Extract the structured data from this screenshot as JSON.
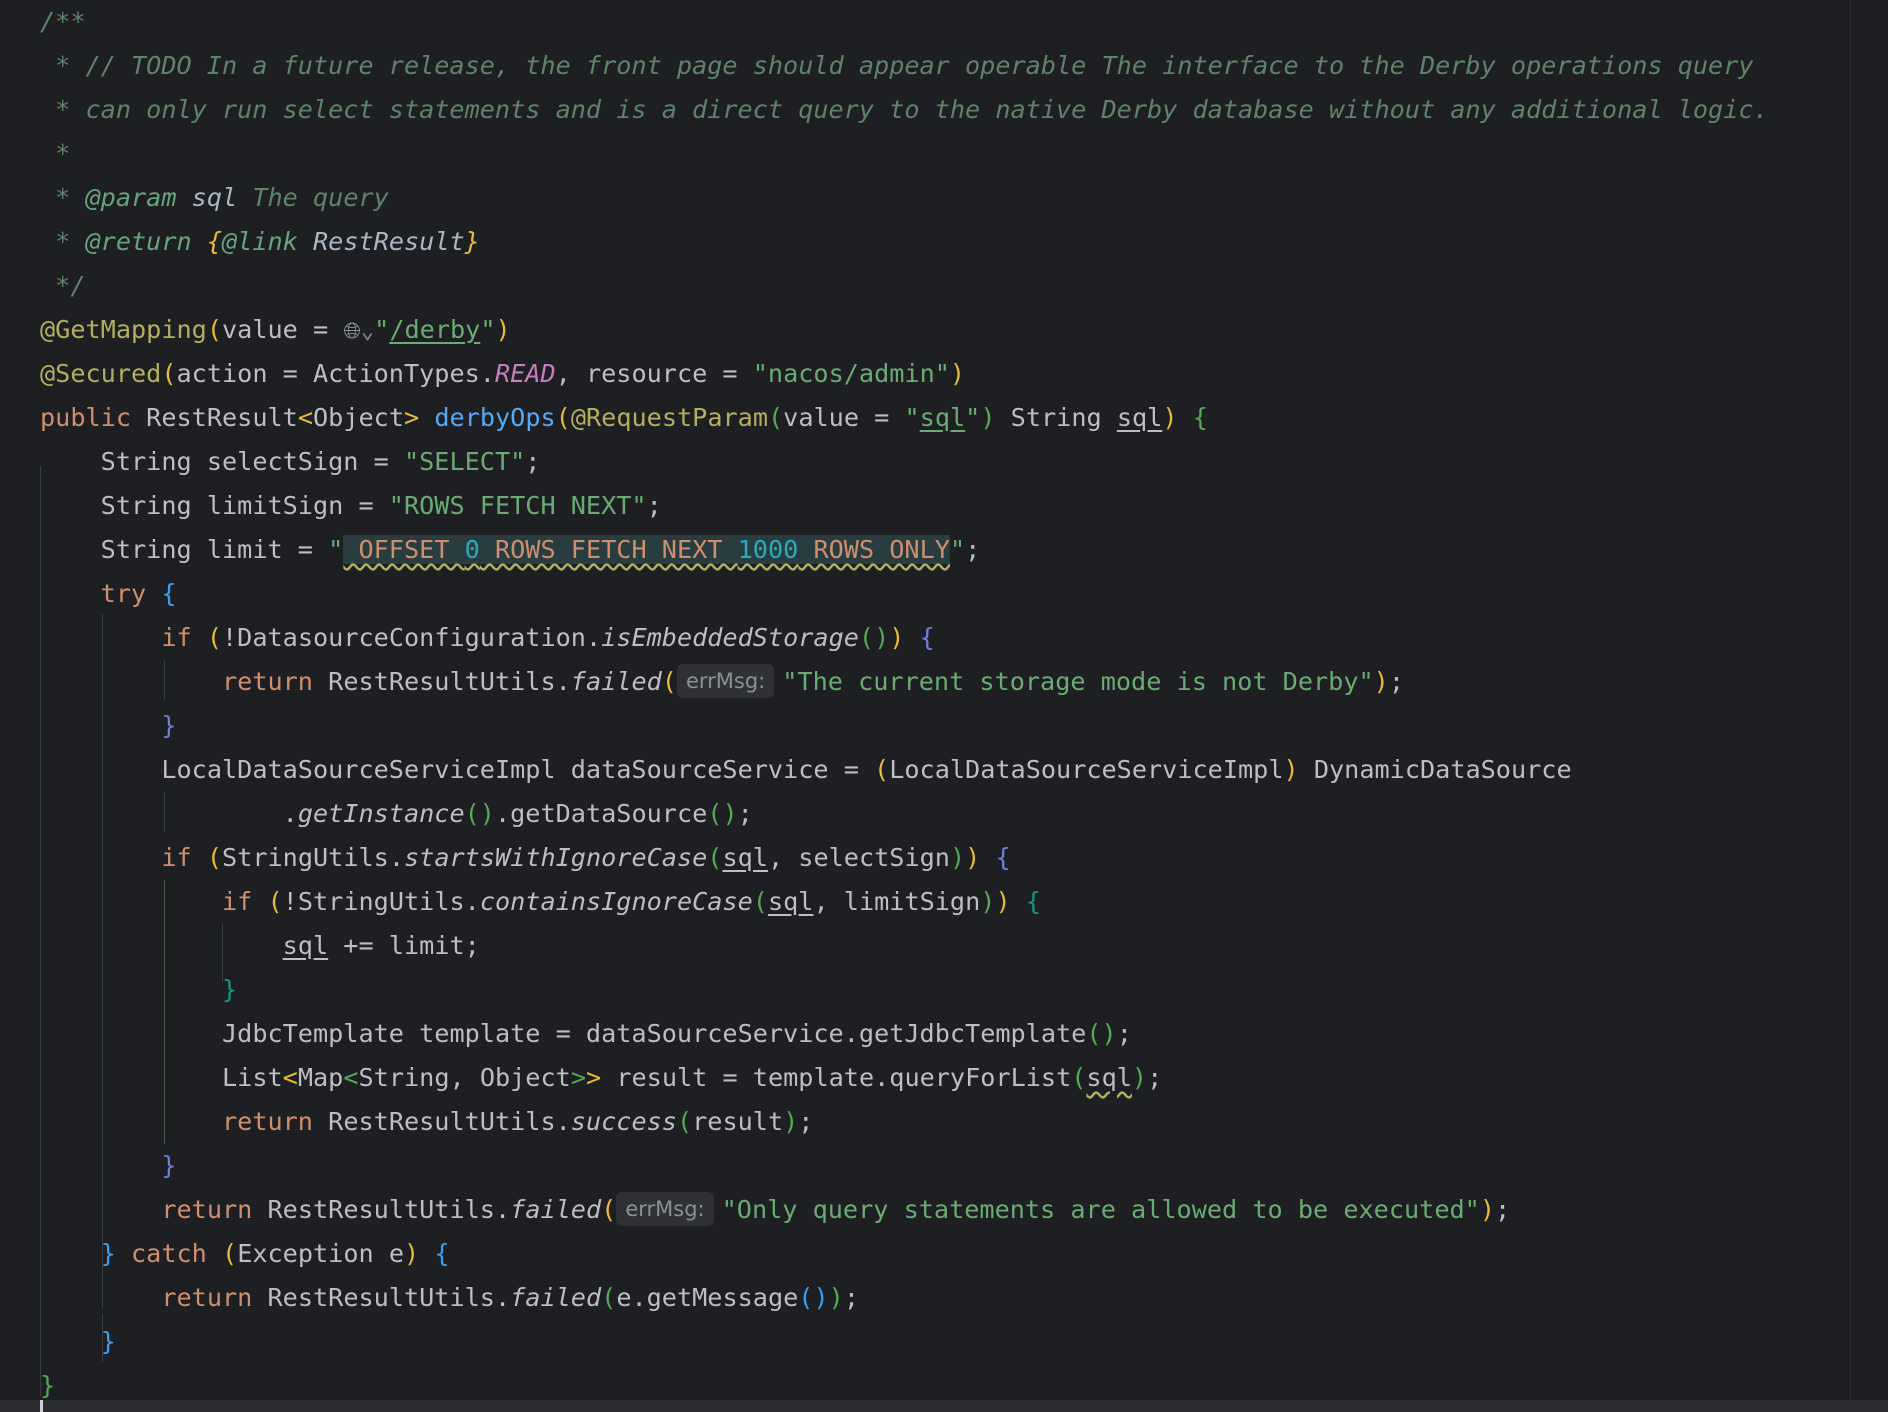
{
  "doc": {
    "open": "/**",
    "todo": " * // TODO In a future release, the front page should appear operable The interface to the Derby operations query",
    "todo2": " * can only run select statements and is a direct query to the native Derby database without any additional logic.",
    "blank": " *",
    "param_prefix": " * ",
    "param_tag": "@param",
    "param_name": "sql",
    "param_desc": "The query",
    "return_tag": "@return",
    "link_open": "{",
    "link_tag": "@link",
    "link_target": "RestResult",
    "link_close": "}",
    "close": " */"
  },
  "annotations": {
    "get_mapping": "@GetMapping",
    "value_eq": "value = ",
    "path": "/derby",
    "secured": "@Secured",
    "action_eq": "action = ActionTypes.",
    "action_const": "READ",
    "resource_eq": ", resource = ",
    "resource_val": "\"nacos/admin\"",
    "globe_icon": "globe-icon"
  },
  "method": {
    "public": "public",
    "return_type": "RestResult",
    "generic": "Object",
    "name": "derbyOps",
    "request_param": "@RequestParam",
    "param_value": "\"sql\"",
    "param_type": "String",
    "param_name": "sql"
  },
  "body": {
    "select_decl": "String selectSign = ",
    "select_val": "\"SELECT\"",
    "limit_sign_decl": "String limitSign = ",
    "limit_sign_val": "\"ROWS FETCH NEXT\"",
    "limit_decl": "String limit = ",
    "limit_val_a": " OFFSET ",
    "limit_num_a": "0",
    "limit_val_b": " ROWS FETCH NEXT ",
    "limit_num_b": "1000",
    "limit_val_c": " ROWS ONLY",
    "try": "try",
    "if": "if",
    "ds_config": "!DatasourceConfiguration.",
    "is_embedded": "isEmbeddedStorage",
    "return": "return",
    "rru": "RestResultUtils.",
    "failed": "failed",
    "success": "success",
    "err_hint": "errMsg:",
    "not_derby": "\"The current storage mode is not Derby\"",
    "local_ds": "LocalDataSourceServiceImpl dataSourceService = ",
    "cast": "LocalDataSourceServiceImpl",
    "dynamic": " DynamicDataSource",
    "get_instance": "getInstance",
    "get_ds": ".getDataSource",
    "string_utils": "StringUtils.",
    "starts_with": "startsWithIgnoreCase",
    "contains": "!StringUtils.",
    "contains_fn": "containsIgnoreCase",
    "sql": "sql",
    "select_sign": ", selectSign",
    "limit_sign": ", limitSign",
    "append": " += limit;",
    "jdbc": "JdbcTemplate template = dataSourceService.getJdbcTemplate",
    "list": "List",
    "map": "Map",
    "map_args": "String, Object",
    "result_eq": " result = template.queryForList",
    "result": "result",
    "only_query": "\"Only query statements are allowed to be executed\"",
    "catch": "catch",
    "exception": "Exception e",
    "get_message": "e.getMessage"
  }
}
